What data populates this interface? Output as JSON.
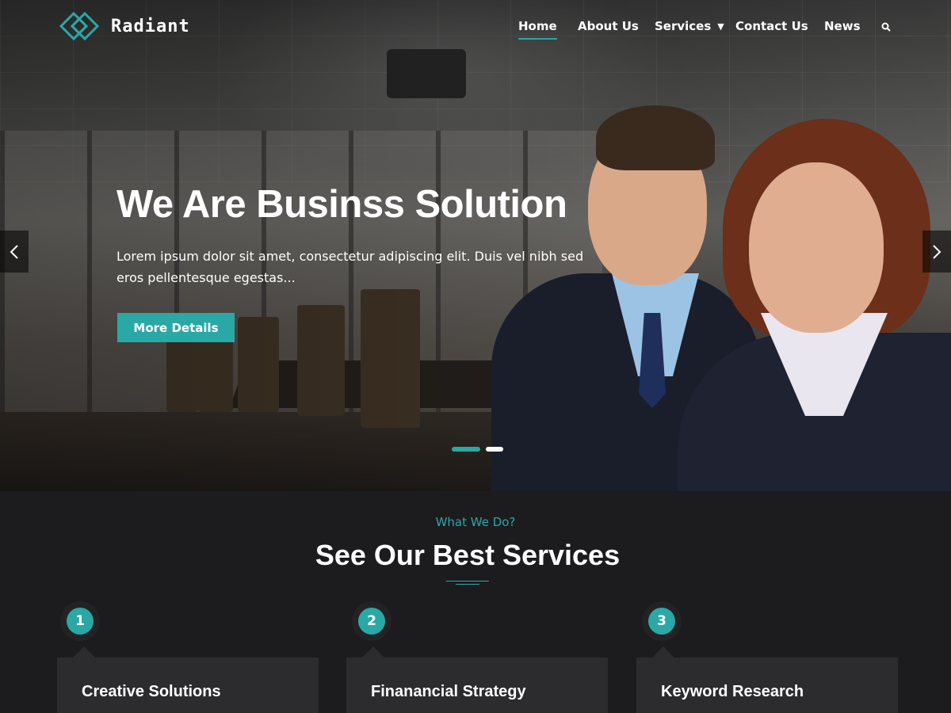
{
  "brand": {
    "name": "Radiant",
    "accent_color": "#2aa8a6",
    "logo_icon": "diamond-logo-icon"
  },
  "nav": {
    "items": [
      {
        "label": "Home",
        "active": true
      },
      {
        "label": "About Us"
      },
      {
        "label": "Services",
        "has_dropdown": true
      },
      {
        "label": "Contact Us"
      },
      {
        "label": "News"
      }
    ],
    "search_icon": "search-icon"
  },
  "hero": {
    "title": "We Are Businss Solution",
    "description": "Lorem ipsum dolor sit amet, consectetur adipiscing elit. Duis vel nibh sed eros pellentesque egestas...",
    "button_label": "More Details",
    "slides_count": 2,
    "active_slide": 1
  },
  "services": {
    "eyebrow": "What We Do?",
    "title": "See Our Best Services",
    "cards": [
      {
        "number": "1",
        "title": "Creative Solutions"
      },
      {
        "number": "2",
        "title": "Finanancial Strategy"
      },
      {
        "number": "3",
        "title": "Keyword Research"
      }
    ]
  }
}
